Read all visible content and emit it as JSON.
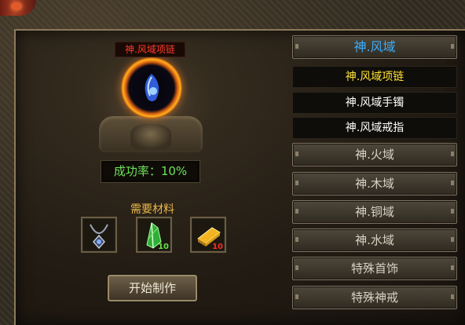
{
  "item": {
    "name": "神.风域项链",
    "success_rate": "成功率：10%"
  },
  "materials": {
    "label": "需要材料",
    "slots": [
      {
        "icon": "amulet-icon",
        "qty": ""
      },
      {
        "icon": "green-crystal-icon",
        "qty": "10"
      },
      {
        "icon": "gold-bar-icon",
        "qty": "10"
      }
    ]
  },
  "start_button": "开始制作",
  "categories": {
    "active": "神.风域",
    "sub_items": [
      "神.风域项链",
      "神.风域手镯",
      "神.风域戒指"
    ],
    "others": [
      "神.火域",
      "神.木域",
      "神.铜域",
      "神.水域",
      "特殊首饰",
      "特殊神戒"
    ]
  },
  "colors": {
    "title_red": "#ff3a2a",
    "rate_green": "#6fe25a",
    "active_blue": "#3aaeff",
    "selected_yellow": "#ffe23a"
  }
}
